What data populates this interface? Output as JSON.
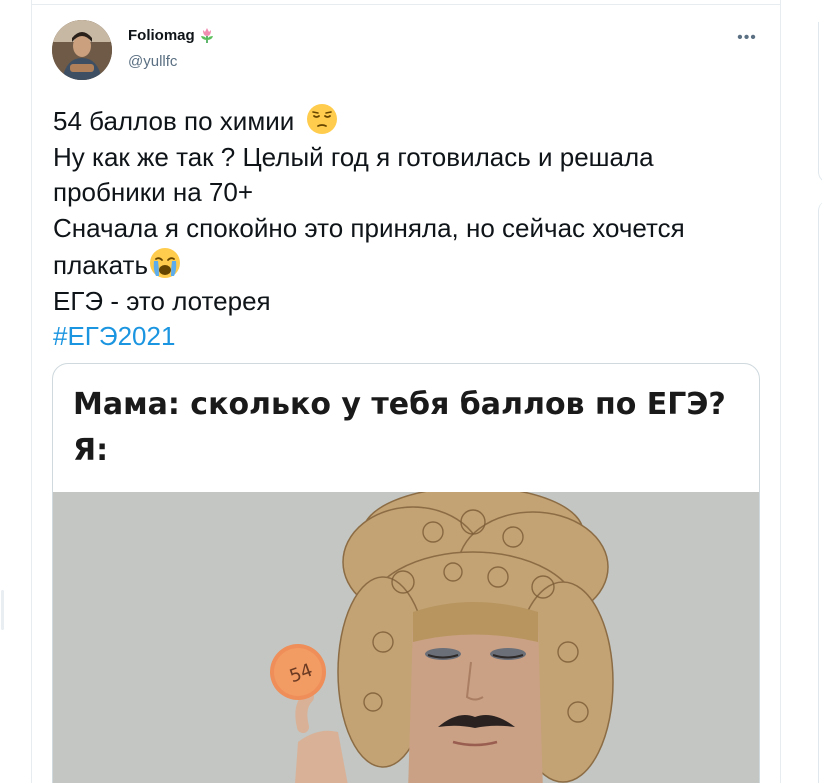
{
  "tweet": {
    "author": {
      "display_name": "Foliomag",
      "handle": "@yullfc",
      "badge_icon": "tulip-icon",
      "avatar_icon": "user-avatar"
    },
    "more_icon": "more-horizontal-icon",
    "more_symbol": "•••",
    "text_lines": [
      "54 баллов по химии",
      "Ну как же так ? Целый год я готовилась и решала",
      "пробники на 70+",
      "Сначала я спокойно это приняла, но сейчас хочется",
      "плакать",
      "ЕГЭ - это лотерея"
    ],
    "hashtag": "#ЕГЭ2021",
    "emojis": [
      "pensive-face-emoji",
      "crying-face-emoji"
    ],
    "colors": {
      "link": "#1b95e0",
      "text": "#0f1419",
      "secondary": "#5b7083",
      "border": "#cfd9de"
    }
  },
  "media": {
    "caption_line1": "Мама: сколько у тебя баллов по ЕГЭ?",
    "caption_line2": "Я:",
    "coin_label": "54"
  }
}
